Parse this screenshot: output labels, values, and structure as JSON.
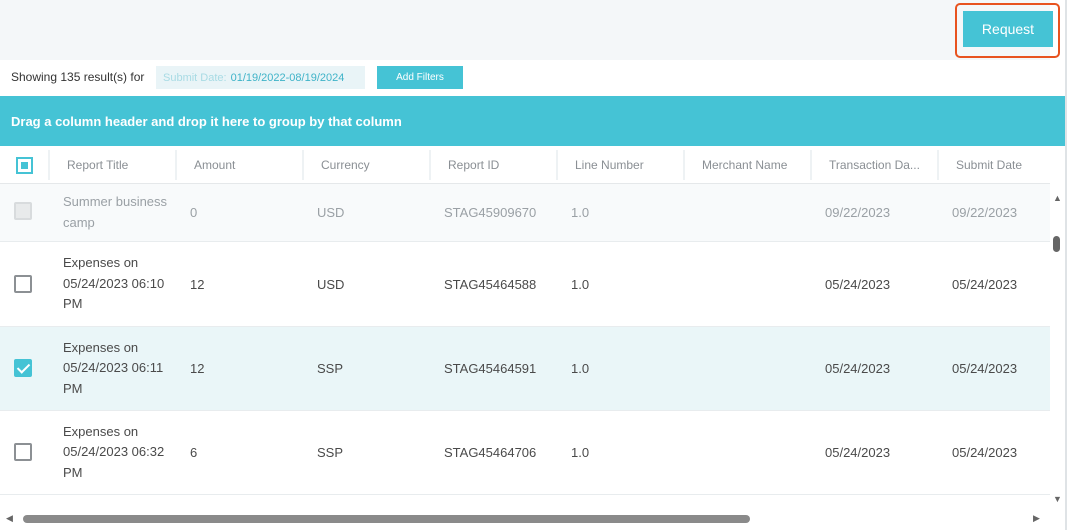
{
  "header": {
    "request_label": "Request"
  },
  "filters": {
    "showing_text": "Showing 135 result(s) for",
    "date_key": "Submit Date:",
    "date_value": "01/19/2022-08/19/2024",
    "add_filters_label": "Add Filters"
  },
  "group_bar": {
    "text": "Drag a column header and drop it here to group by that column"
  },
  "columns": [
    "Report Title",
    "Amount",
    "Currency",
    "Report ID",
    "Line Number",
    "Merchant Name",
    "Transaction Da...",
    "Submit Date"
  ],
  "rows": [
    {
      "title": "Summer business camp",
      "amount": "0",
      "currency": "USD",
      "report_id": "STAG45909670",
      "line_number": "1.0",
      "merchant": "",
      "transaction_date": "09/22/2023",
      "submit_date": "09/22/2023",
      "checked": false,
      "disabled": true
    },
    {
      "title": "Expenses on 05/24/2023 06:10 PM",
      "amount": "12",
      "currency": "USD",
      "report_id": "STAG45464588",
      "line_number": "1.0",
      "merchant": "",
      "transaction_date": "05/24/2023",
      "submit_date": "05/24/2023",
      "checked": false,
      "disabled": false
    },
    {
      "title": "Expenses on 05/24/2023 06:11 PM",
      "amount": "12",
      "currency": "SSP",
      "report_id": "STAG45464591",
      "line_number": "1.0",
      "merchant": "",
      "transaction_date": "05/24/2023",
      "submit_date": "05/24/2023",
      "checked": true,
      "disabled": false
    },
    {
      "title": "Expenses on 05/24/2023 06:32 PM",
      "amount": "6",
      "currency": "SSP",
      "report_id": "STAG45464706",
      "line_number": "1.0",
      "merchant": "",
      "transaction_date": "05/24/2023",
      "submit_date": "05/24/2023",
      "checked": false,
      "disabled": false
    }
  ],
  "colors": {
    "accent": "#45c3d5",
    "highlight": "#e8531f",
    "selected_row": "#eaf6f8"
  },
  "icons": [
    "checkbox-icon",
    "scroll-up-icon",
    "scroll-down-icon",
    "scroll-left-icon",
    "scroll-right-icon"
  ]
}
